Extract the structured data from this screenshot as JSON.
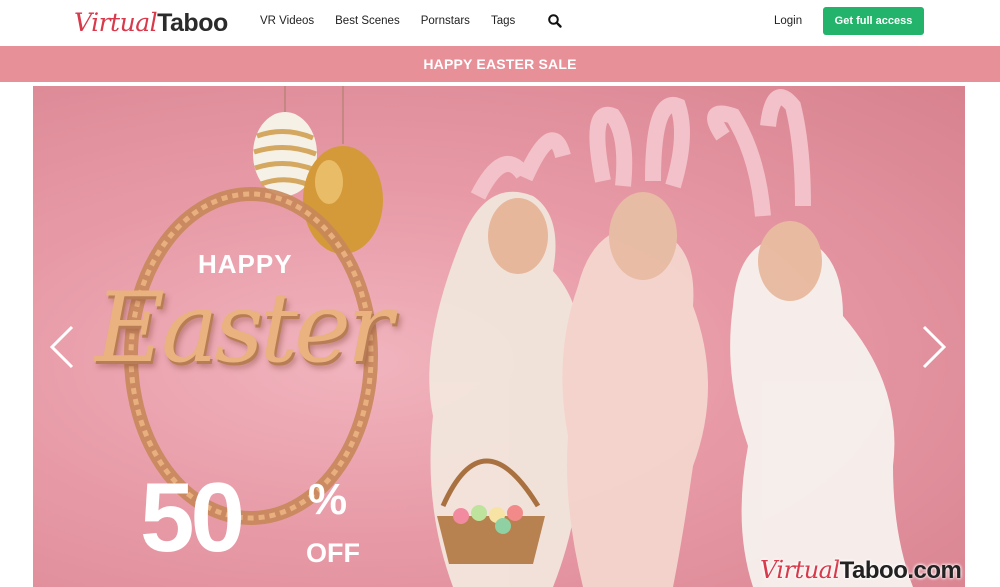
{
  "header": {
    "logo": {
      "part1": "Virtual",
      "part2": "Taboo"
    },
    "nav": [
      "VR Videos",
      "Best Scenes",
      "Pornstars",
      "Tags"
    ],
    "search_icon": "search-icon",
    "login_label": "Login",
    "cta_label": "Get full access"
  },
  "sale_bar": {
    "text": "HAPPY EASTER SALE"
  },
  "banner": {
    "happy": "HAPPY",
    "easter": "Easter",
    "discount_number": "50",
    "discount_sign": "%",
    "discount_off": "OFF",
    "watermark": {
      "part1": "Virtual",
      "part2": "Taboo.com"
    },
    "arrow_left_icon": "chevron-left-icon",
    "arrow_right_icon": "chevron-right-icon"
  },
  "colors": {
    "brand_red": "#d83a4c",
    "cta_green": "#23b36a",
    "sale_bar_pink": "#e89098",
    "banner_pink": "#e79aa6",
    "gold": "#e9b27e"
  }
}
